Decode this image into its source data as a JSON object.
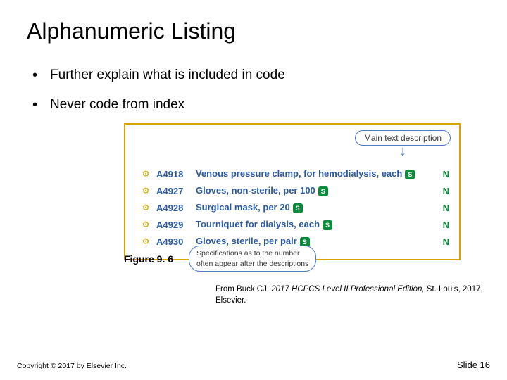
{
  "title": "Alphanumeric Listing",
  "bullets": [
    "Further explain what is included in code",
    "Never code from index"
  ],
  "figure": {
    "main_desc_label": "Main text description",
    "codes": [
      {
        "code": "A4918",
        "desc": "Venous pressure clamp, for hemodialysis, each",
        "n": "N"
      },
      {
        "code": "A4927",
        "desc": "Gloves, non-sterile, per 100",
        "n": "N"
      },
      {
        "code": "A4928",
        "desc": "Surgical mask, per 20",
        "n": "N"
      },
      {
        "code": "A4929",
        "desc": "Tourniquet for dialysis, each",
        "n": "N"
      },
      {
        "code": "A4930",
        "desc": "Gloves, sterile, per pair",
        "n": "N"
      }
    ],
    "spec_label_line1": "Specifications as to the number",
    "spec_label_line2": "often appear after the descriptions",
    "label": "Figure 9. 6"
  },
  "citation": {
    "prefix": "From Buck CJ: ",
    "title": "2017 HCPCS Level II Professional Edition,",
    "suffix": " St. Louis, 2017, Elsevier."
  },
  "copyright": "Copyright © 2017 by Elsevier Inc.",
  "slide_number": "Slide 16"
}
